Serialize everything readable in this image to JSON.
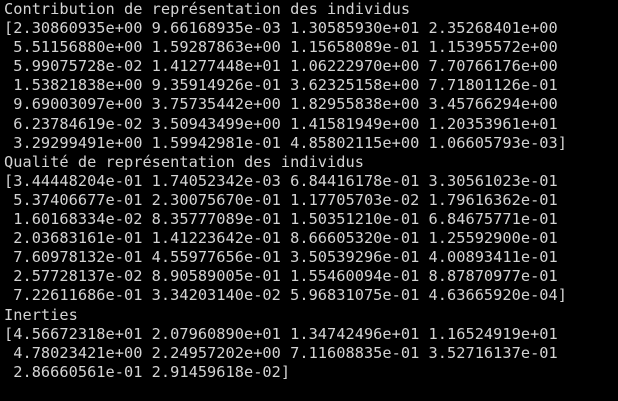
{
  "terminal": {
    "lines": [
      "Contribution de représentation des individus",
      "[2.30860935e+00 9.66168935e-03 1.30585930e+01 2.35268401e+00",
      " 5.51156880e+00 1.59287863e+00 1.15658089e-01 1.15395572e+00",
      " 5.99075728e-02 1.41277448e+01 1.06222970e+00 7.70766176e+00",
      " 1.53821838e+00 9.35914926e-01 3.62325158e+00 7.71801126e-01",
      " 9.69003097e+00 3.75735442e+00 1.82955838e+00 3.45766294e+00",
      " 6.23784619e-02 3.50943499e+00 1.41581949e+00 1.20353961e+01",
      " 3.29299491e+00 1.59942981e-01 4.85802115e+00 1.06605793e-03]",
      "Qualité de représentation des individus",
      "[3.44448204e-01 1.74052342e-03 6.84416178e-01 3.30561023e-01",
      " 5.37406677e-01 2.30075670e-01 1.17705703e-02 1.79616362e-01",
      " 1.60168334e-02 8.35777089e-01 1.50351210e-01 6.84675771e-01",
      " 2.03683161e-01 1.41223642e-01 8.66605320e-01 1.25592900e-01",
      " 7.60978132e-01 4.55977656e-01 3.50539296e-01 4.00893411e-01",
      " 2.57728137e-02 8.90589005e-01 1.55460094e-01 8.87870977e-01",
      " 7.22611686e-01 3.34203140e-02 5.96831075e-01 4.63665920e-04]",
      "Inerties",
      "[4.56672318e+01 2.07960890e+01 1.34742496e+01 1.16524919e+01",
      " 4.78023421e+00 2.24957202e+00 7.11608835e-01 3.52716137e-01",
      " 2.86660561e-01 2.91459618e-02]"
    ]
  }
}
